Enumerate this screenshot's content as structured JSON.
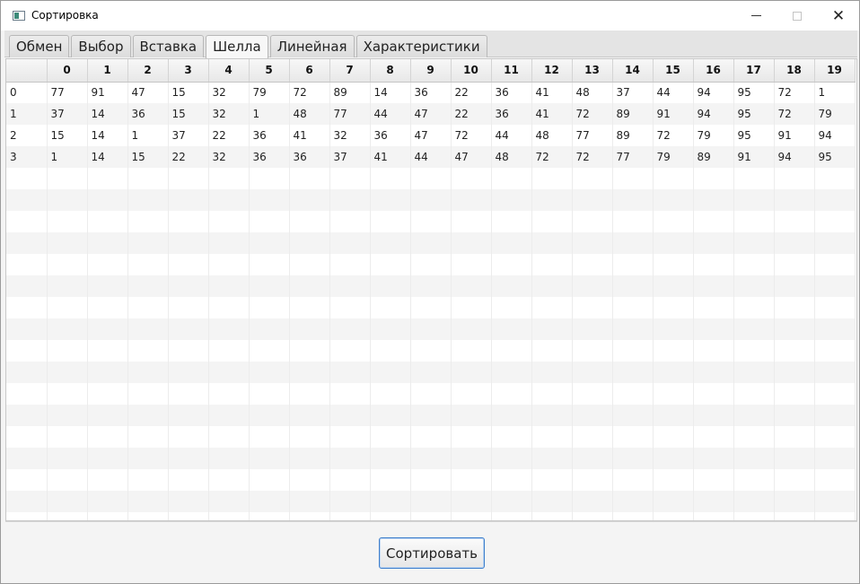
{
  "window": {
    "title": "Сортировка"
  },
  "tabs": [
    "Обмен",
    "Выбор",
    "Вставка",
    "Шелла",
    "Линейная",
    "Характеристики"
  ],
  "selected_tab": 3,
  "table": {
    "columns": [
      "",
      "0",
      "1",
      "2",
      "3",
      "4",
      "5",
      "6",
      "7",
      "8",
      "9",
      "10",
      "11",
      "12",
      "13",
      "14",
      "15",
      "16",
      "17",
      "18",
      "19"
    ],
    "rows": [
      [
        "0",
        "77",
        "91",
        "47",
        "15",
        "32",
        "79",
        "72",
        "89",
        "14",
        "36",
        "22",
        "36",
        "41",
        "48",
        "37",
        "44",
        "94",
        "95",
        "72",
        "1"
      ],
      [
        "1",
        "37",
        "14",
        "36",
        "15",
        "32",
        "1",
        "48",
        "77",
        "44",
        "47",
        "22",
        "36",
        "41",
        "72",
        "89",
        "91",
        "94",
        "95",
        "72",
        "79"
      ],
      [
        "2",
        "15",
        "14",
        "1",
        "37",
        "22",
        "36",
        "41",
        "32",
        "36",
        "47",
        "72",
        "44",
        "48",
        "77",
        "89",
        "72",
        "79",
        "95",
        "91",
        "94"
      ],
      [
        "3",
        "1",
        "14",
        "15",
        "22",
        "32",
        "36",
        "36",
        "37",
        "41",
        "44",
        "47",
        "48",
        "72",
        "72",
        "77",
        "79",
        "89",
        "91",
        "94",
        "95"
      ]
    ],
    "empty_rows": 17
  },
  "sort_button": "Сортировать"
}
